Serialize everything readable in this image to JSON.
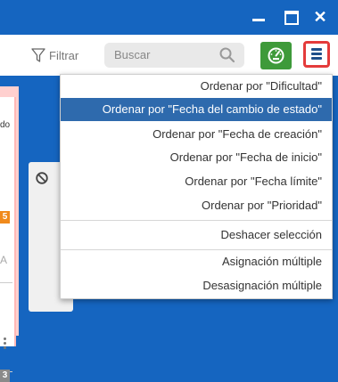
{
  "toolbar": {
    "filter_label": "Filtrar",
    "search_placeholder": "Buscar"
  },
  "board": {
    "left_column": {
      "label_fragment": "do",
      "badge_top": "5",
      "badge_bottom": "3",
      "letter_a": "A"
    }
  },
  "dropdown": {
    "items": [
      {
        "label": "Ordenar por \"Dificultad\""
      },
      {
        "label": "Ordenar por \"Fecha del cambio de estado\"",
        "selected": true
      },
      {
        "label": "Ordenar por \"Fecha de creación\""
      },
      {
        "label": "Ordenar por \"Fecha de inicio\""
      },
      {
        "label": "Ordenar por \"Fecha límite\""
      },
      {
        "label": "Ordenar por \"Prioridad\""
      },
      {
        "label": "Deshacer selección"
      },
      {
        "label": "Asignación múltiple"
      },
      {
        "label": "Desasignación múltiple"
      }
    ]
  },
  "colors": {
    "header_blue": "#1565c0",
    "selected_blue": "#2e6aad",
    "dashboard_green": "#3e9a3a",
    "menu_border_red": "#e43b3b",
    "badge_orange": "#f08a1c"
  },
  "icons": [
    "minimize-icon",
    "maximize-icon",
    "close-icon",
    "filter-icon",
    "search-icon",
    "dashboard-gauge-icon",
    "hamburger-menu-icon",
    "blocked-icon"
  ]
}
